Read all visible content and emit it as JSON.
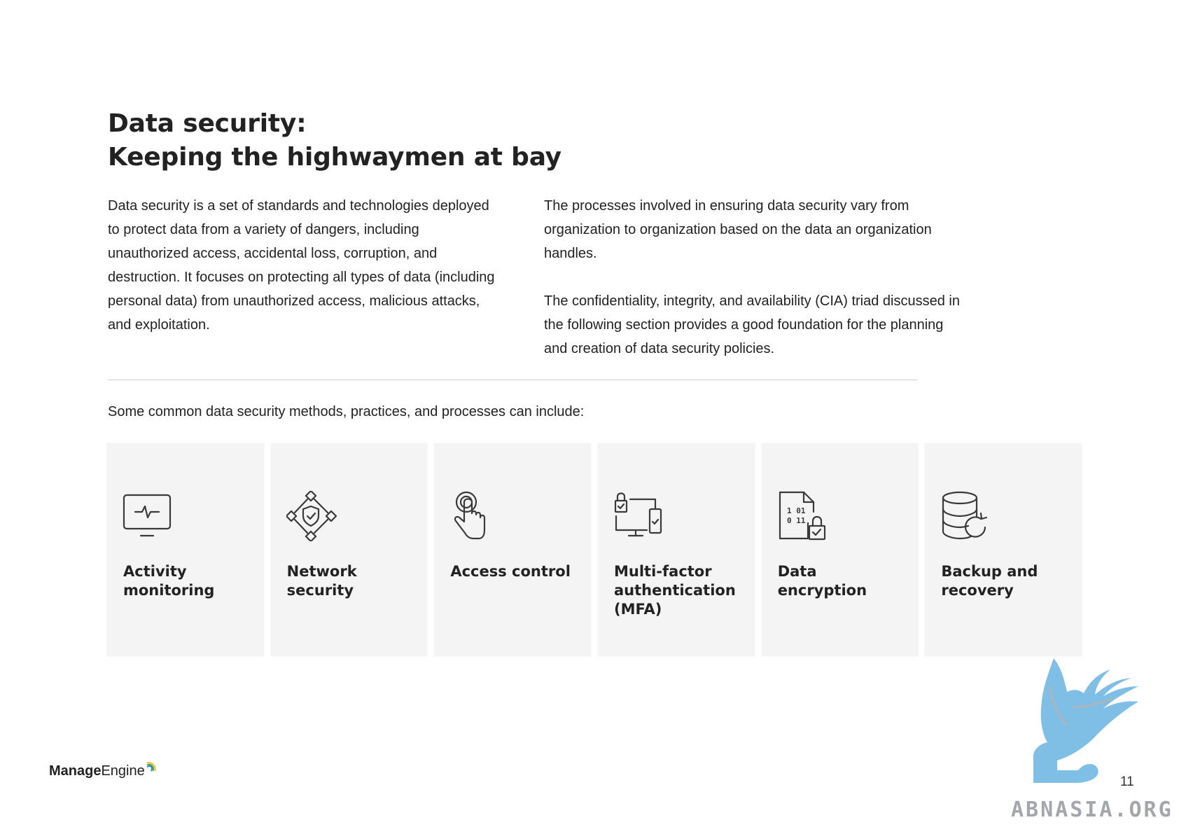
{
  "heading": {
    "line1": "Data security:",
    "line2": "Keeping the highwaymen at bay"
  },
  "left_paragraph": "Data security is a set of standards and technologies deployed to protect data from a variety of dangers, including unauthorized access, accidental loss, corruption, and destruction. It focuses on protecting all types of data (including personal data) from unauthorized access, malicious attacks, and exploitation.",
  "right_paragraphs": [
    "The processes involved in ensuring data security vary from organization to organization based on the data an organization handles.",
    "The confidentiality, integrity, and availability (CIA) triad discussed in the following section provides a good foundation for the planning and creation of data security policies."
  ],
  "intro": "Some common data security methods, practices, and processes can include:",
  "cards": [
    {
      "label": "Activity monitoring",
      "icon": "monitor-heartbeat-icon"
    },
    {
      "label": "Network security",
      "icon": "network-shield-icon"
    },
    {
      "label": "Access control",
      "icon": "fingerprint-touch-icon"
    },
    {
      "label": "Multi-factor authentication (MFA)",
      "icon": "multi-device-lock-icon"
    },
    {
      "label": "Data encryption",
      "icon": "binary-file-lock-icon"
    },
    {
      "label": "Backup and recovery",
      "icon": "database-restore-icon"
    }
  ],
  "footer": {
    "logo_bold": "Manage",
    "logo_regular": "Engine",
    "page_number": "11",
    "watermark": "ABNASIA.ORG"
  },
  "colors": {
    "card_bg": "#f4f4f5",
    "icon_stroke": "#3a3a3a",
    "watermark_bird": "#7fbfe6",
    "watermark_text": "#a3a6ab"
  }
}
